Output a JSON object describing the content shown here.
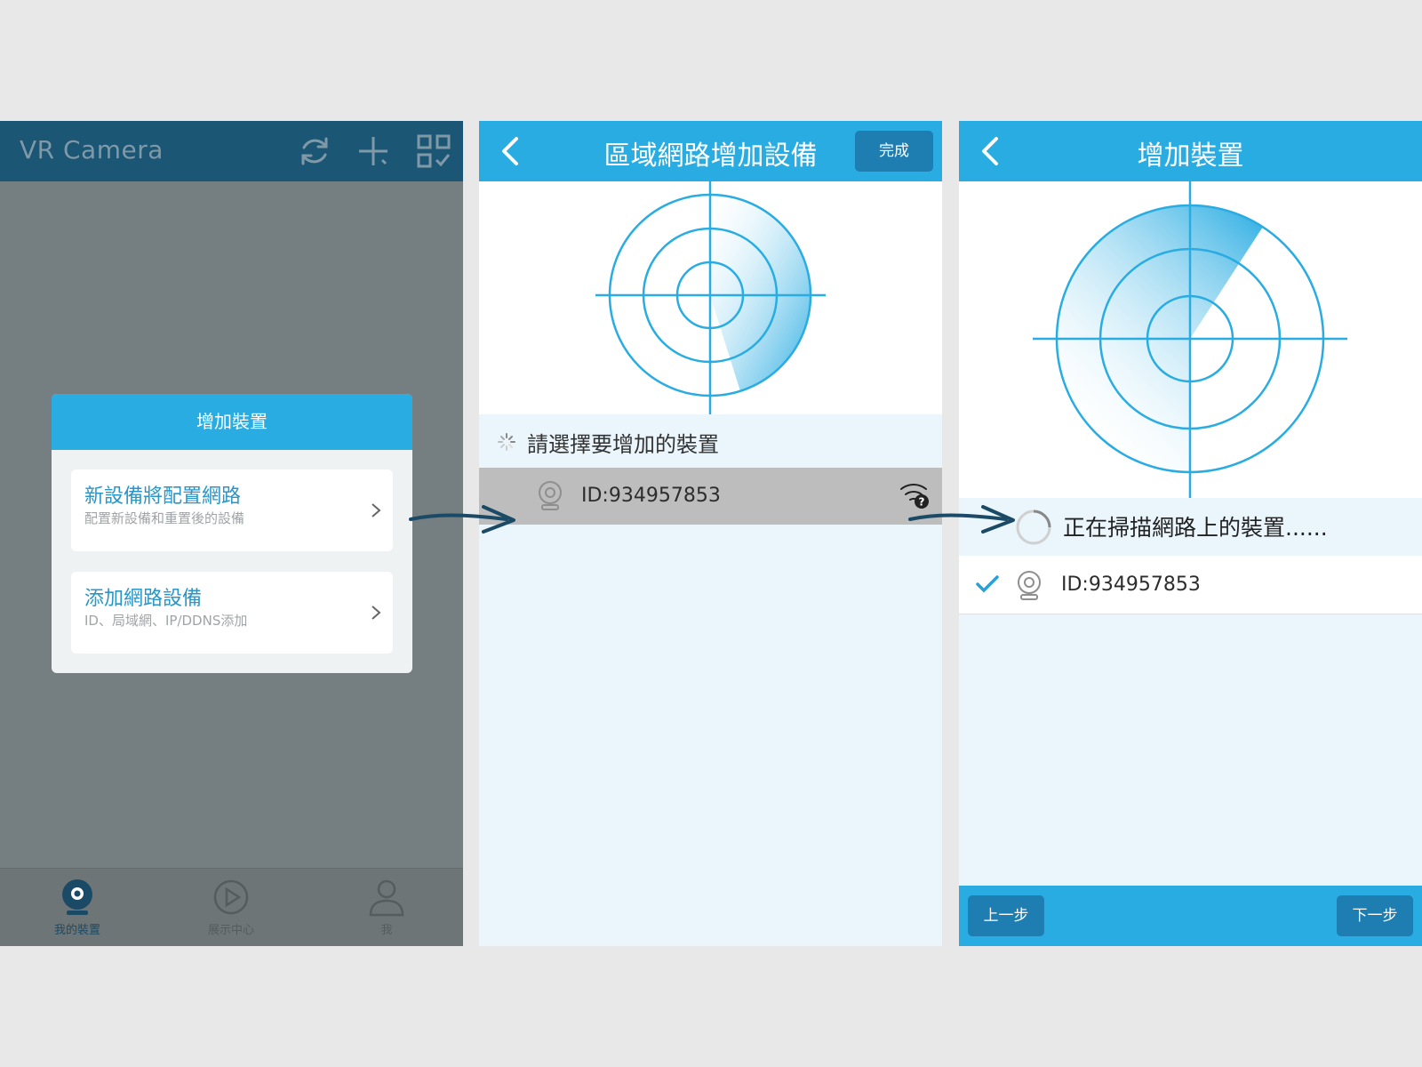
{
  "screen1": {
    "app_title": "VR Camera",
    "toolbar_icons": [
      "refresh-icon",
      "plus-icon",
      "qr-scan-icon"
    ],
    "dialog": {
      "title": "增加裝置",
      "options": [
        {
          "title": "新設備將配置網路",
          "subtitle": "配置新設備和重置後的設備"
        },
        {
          "title": "添加網路設備",
          "subtitle": "ID、局域網、IP/DDNS添加"
        }
      ]
    },
    "nav": [
      {
        "label": "我的裝置",
        "icon": "camera-icon",
        "active": true
      },
      {
        "label": "展示中心",
        "icon": "play-circle-icon",
        "active": false
      },
      {
        "label": "我",
        "icon": "person-icon",
        "active": false
      }
    ]
  },
  "screen2": {
    "title": "區域網路增加設備",
    "done_label": "完成",
    "status_text": "請選擇要增加的裝置",
    "device_id": "ID:934957853"
  },
  "screen3": {
    "title": "增加裝置",
    "status_text": "正在掃描網路上的裝置......",
    "device_id": "ID:934957853",
    "prev_label": "上一步",
    "next_label": "下一步"
  },
  "colors": {
    "primary": "#29ace2",
    "dark_button": "#1e7db1",
    "topbar_dark": "#1b5674",
    "overlay": "#757e80",
    "panel_bg": "#eaf5fc",
    "arrow": "#1b4a66"
  }
}
